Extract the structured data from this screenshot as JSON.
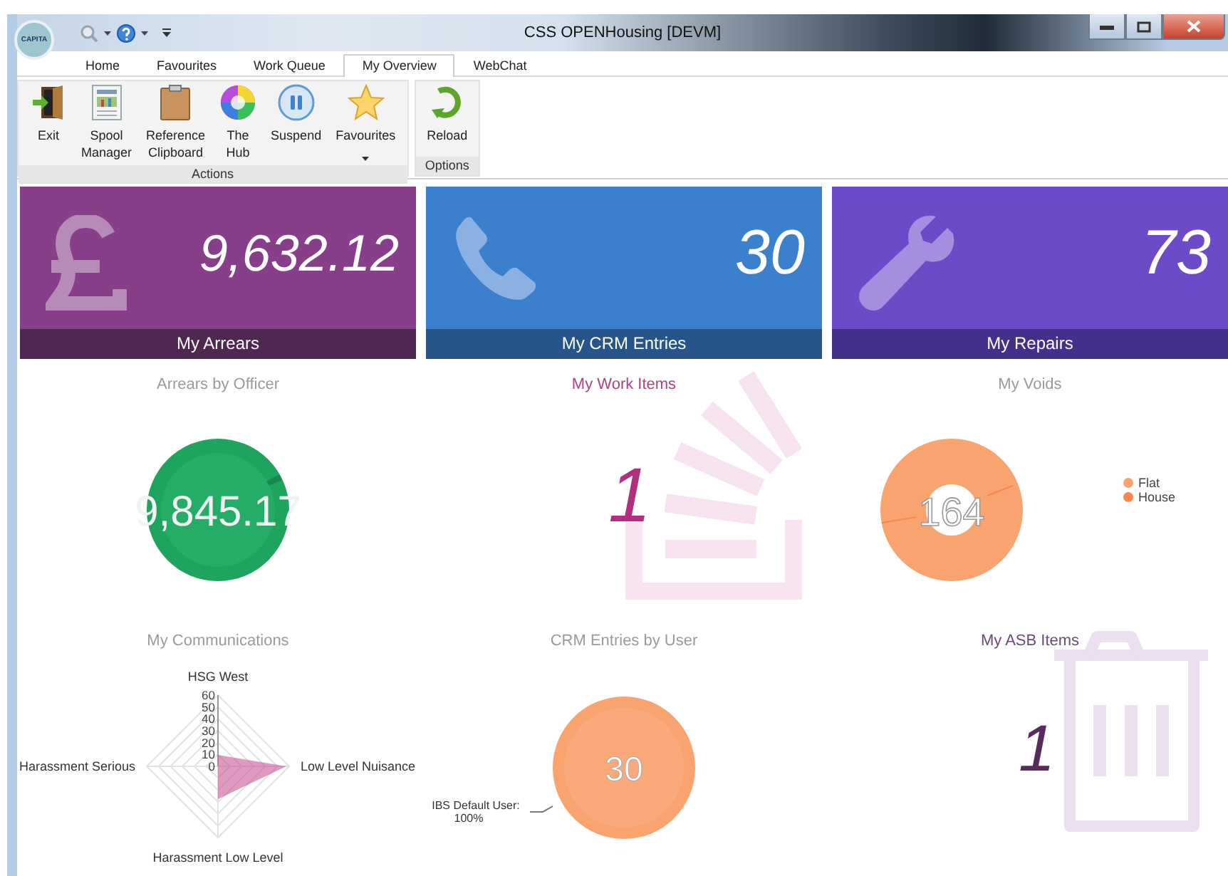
{
  "window": {
    "title": "CSS OPENHousing [DEVM]",
    "logo_text": "CAPITA"
  },
  "tabs": [
    {
      "label": "Home",
      "selected": false
    },
    {
      "label": "Favourites",
      "selected": false
    },
    {
      "label": "Work Queue",
      "selected": false
    },
    {
      "label": "My Overview",
      "selected": true
    },
    {
      "label": "WebChat",
      "selected": false
    }
  ],
  "ribbon_groups": [
    {
      "label": "Actions",
      "buttons": [
        {
          "label": "Exit",
          "kind": "door",
          "dropdown": false
        },
        {
          "label": "Spool Manager",
          "kind": "report",
          "dropdown": false
        },
        {
          "label": "Reference Clipboard",
          "kind": "clipboard",
          "dropdown": false
        },
        {
          "label": "The Hub",
          "kind": "wheel",
          "dropdown": false
        },
        {
          "label": "Suspend",
          "kind": "pause",
          "dropdown": false
        },
        {
          "label": "Favourites",
          "kind": "star",
          "dropdown": true
        }
      ]
    },
    {
      "label": "Options",
      "buttons": [
        {
          "label": "Reload",
          "kind": "reload",
          "dropdown": false
        }
      ]
    }
  ],
  "tiles": [
    {
      "kind": "pound",
      "value": "9,632.12",
      "label": "My Arrears"
    },
    {
      "kind": "phone",
      "value": "30",
      "label": "My CRM Entries"
    },
    {
      "kind": "wrench",
      "value": "73",
      "label": "My Repairs"
    }
  ],
  "panels": [
    {
      "kind": "pie",
      "title": "Arrears by Officer",
      "value": "9,845.17"
    },
    {
      "kind": "stack-count",
      "title": "My Work Items",
      "value": "1"
    },
    {
      "kind": "donut",
      "title": "My Voids",
      "value": "164",
      "legend": [
        {
          "label": "Flat",
          "color": "#f9a36f"
        },
        {
          "label": "House",
          "color": "#f7874a"
        }
      ]
    },
    {
      "kind": "radar",
      "title": "My Communications",
      "ticks": [
        "60",
        "50",
        "40",
        "30",
        "20",
        "10",
        "0"
      ],
      "axes": [
        "HSG West",
        "Low Level Nuisance",
        "Harassment Low Level",
        "Harassment Serious"
      ]
    },
    {
      "kind": "pie-callout",
      "title": "CRM Entries by User",
      "value": "30",
      "callout_label": "IBS Default User:",
      "callout_value": "100%"
    },
    {
      "kind": "trash-count",
      "title": "My ASB Items",
      "value": "1"
    }
  ]
}
